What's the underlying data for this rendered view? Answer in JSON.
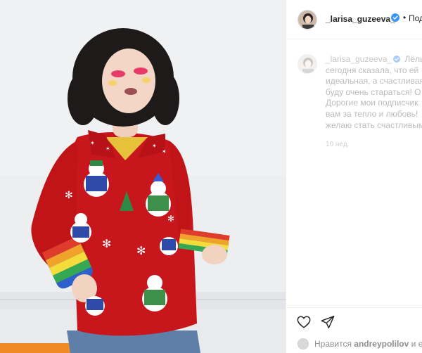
{
  "post": {
    "username": "_larisa_guzeeva_",
    "follow_label": "Под",
    "dot": "•",
    "caption_lines": [
      "Лёль",
      "сегодня сказала, что ей",
      "идеальная, а счастливая",
      "буду очень стараться! О",
      "Дорогие мои подписчик",
      "вам за тепло и любовь!",
      "желаю стать счастливым"
    ],
    "timestamp": "10 нед.",
    "likes_prefix": "Нравится",
    "likes_user": "andreypolilov",
    "likes_suffix": "и е"
  },
  "icons": {
    "heart": "heart-icon",
    "share": "share-icon",
    "verified": "verified-badge-icon"
  },
  "colors": {
    "sweater": "#c8161d",
    "wall": "#ecedef",
    "accent_blue": "#3897f0",
    "text": "#262626",
    "muted": "#8e8e8e"
  }
}
